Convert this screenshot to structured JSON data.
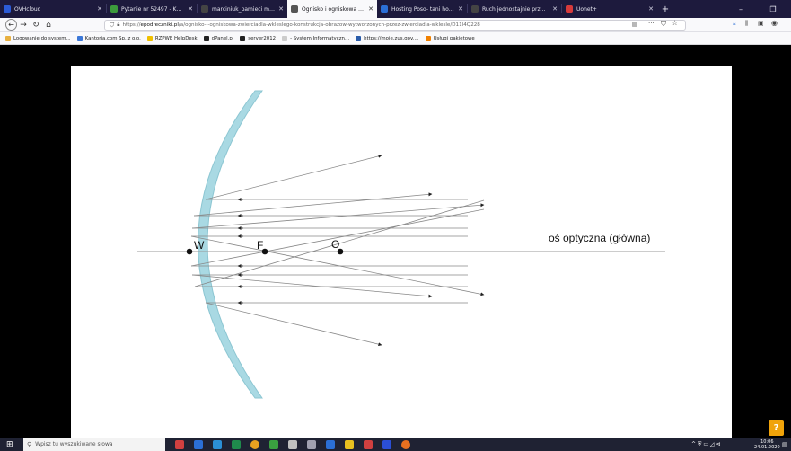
{
  "browser": {
    "tabs": [
      {
        "label": "OVHcloud",
        "fav": "#2c5bd6"
      },
      {
        "label": "Pytanie nr 52497 - Kwalifikacje",
        "fav": "#3c9a3c"
      },
      {
        "label": "marciniuk_pamieci masowe.pdf",
        "fav": "#444444"
      },
      {
        "label": "Ognisko i ogniskowa zwierciadl",
        "fav": "#555555",
        "active": true
      },
      {
        "label": "Hosting Poso- tani hosting w",
        "fav": "#2b6fd6"
      },
      {
        "label": "Ruch jednostajnie przyspieszo",
        "fav": "#444444"
      },
      {
        "label": "Uonet+",
        "fav": "#d83b3b"
      }
    ],
    "url": {
      "prefix": "https://",
      "host": "epodreczniki.pl",
      "path": "/a/ognisko-i-ogniskowa-zwierciadla-wkleslego-konstrukcja-obrazow-wytworzonych-przez-zwierciadla-wklesle/D11l4Q228"
    },
    "bookmarks": [
      {
        "label": "Logowanie do system...",
        "fav": "#e8b040"
      },
      {
        "label": "Kantoria.com Sp. z o.o.",
        "fav": "#3c78d8"
      },
      {
        "label": "RZPWE HelpDesk",
        "fav": "#f0c000"
      },
      {
        "label": "dPanel.pl",
        "fav": "#222222"
      },
      {
        "label": "server2012",
        "fav": "#222222"
      },
      {
        "label": "- System Informatyczn...",
        "fav": "#cccccc"
      },
      {
        "label": "https://moje.zus.gov....",
        "fav": "#2a5caa"
      },
      {
        "label": "Usługi pakietowe",
        "fav": "#f08000"
      }
    ]
  },
  "diagram": {
    "axis_label": "oś optyczna (główna)",
    "point_w": "W",
    "point_f": "F",
    "point_o": "O",
    "mirror_color": "#a9d9e3",
    "ray_color": "#888888"
  },
  "help_label": "?",
  "taskbar": {
    "search_placeholder": "Wpisz tu wyszukiwane słowa",
    "time": "10:06",
    "date": "24.01.2020"
  }
}
